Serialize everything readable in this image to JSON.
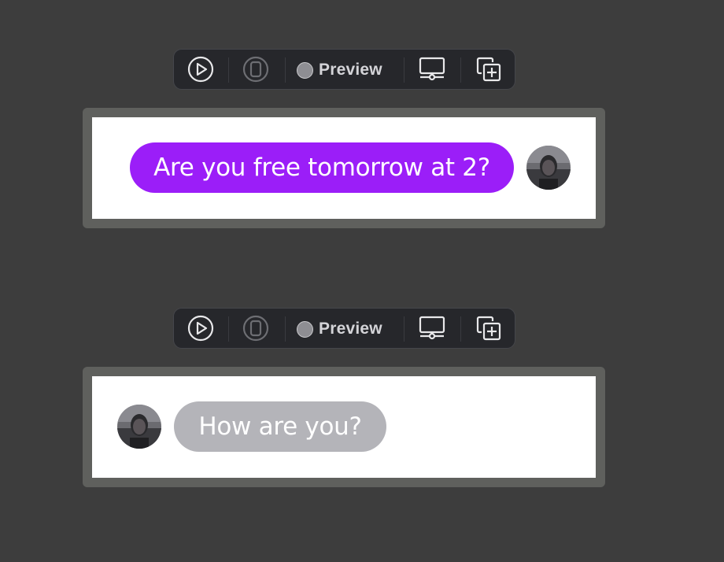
{
  "toolbar": {
    "live_icon": "play-circle-icon",
    "selectable_icon": "device-select-icon",
    "preview_label": "Preview",
    "device_settings_icon": "device-settings-icon",
    "duplicate_icon": "duplicate-preview-icon"
  },
  "previews": [
    {
      "message": "Are you free tomorrow at 2?",
      "direction": "sent",
      "bubble_color": "#9b1ef8"
    },
    {
      "message": "How are you?",
      "direction": "received",
      "bubble_color": "#b4b4b9"
    }
  ],
  "colors": {
    "background": "#3d3d3d",
    "toolbar": "#26272b",
    "frame": "#5f605d"
  }
}
